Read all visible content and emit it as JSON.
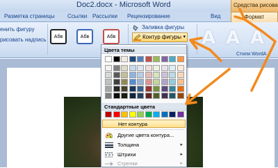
{
  "window": {
    "title": "Doc2.docx - Microsoft Word"
  },
  "context_group": {
    "label": "Средства рисования"
  },
  "tabs": [
    {
      "label": "Разметка страницы"
    },
    {
      "label": "Ссылки"
    },
    {
      "label": "Рассылки"
    },
    {
      "label": "Рецензирование"
    },
    {
      "label": "Вид"
    },
    {
      "label": "Формат"
    }
  ],
  "ribbon": {
    "change_shape": "енить фигуру",
    "draw_text": "рисовать надпись",
    "style_swatch_label": "Абв",
    "shape_fill": "Заливка фигуры",
    "shape_outline": "Контур фигуры",
    "wordart_styles": "Стили WordA",
    "bigA_letter": "A"
  },
  "menu": {
    "theme_colors_header": "Цвета темы",
    "standard_colors_header": "Стандартные цвета",
    "no_outline": "Нет контура",
    "more_colors": "Другие цвета контура...",
    "weight": "Толщина",
    "dashes": "Штрихи",
    "arrows": "Стрелки",
    "theme_top_row": [
      "#ffffff",
      "#000000",
      "#eeece1",
      "#1f497d",
      "#4f81bd",
      "#c0504d",
      "#9bbb59",
      "#8064a2",
      "#4bacc6",
      "#f79646"
    ],
    "theme_shades": [
      [
        "#f2f2f2",
        "#7f7f7f",
        "#ddd9c3",
        "#c6d9f0",
        "#dbe5f1",
        "#f2dcdb",
        "#ebf1dd",
        "#e5e0ec",
        "#dbeef3",
        "#fdeada"
      ],
      [
        "#d8d8d8",
        "#595959",
        "#c4bd97",
        "#8db3e2",
        "#b8cce4",
        "#e5b9b7",
        "#d7e3bc",
        "#ccc1d9",
        "#b7dde8",
        "#fbd5b5"
      ],
      [
        "#bfbfbf",
        "#3f3f3f",
        "#938953",
        "#548dd4",
        "#95b3d7",
        "#d99694",
        "#c3d69b",
        "#b2a2c7",
        "#92cddc",
        "#fac08f"
      ],
      [
        "#a5a5a5",
        "#262626",
        "#494429",
        "#17365d",
        "#366092",
        "#953734",
        "#76923c",
        "#5f497a",
        "#31859b",
        "#e36c09"
      ],
      [
        "#7f7f7f",
        "#0c0c0c",
        "#1d1b10",
        "#0f243e",
        "#244061",
        "#632423",
        "#4f6128",
        "#3f3151",
        "#205867",
        "#974806"
      ]
    ],
    "standard_colors": [
      "#c00000",
      "#ff0000",
      "#ffc000",
      "#ffff00",
      "#92d050",
      "#00b050",
      "#00b0f0",
      "#0070c0",
      "#002060",
      "#7030a0"
    ]
  },
  "annotation": {
    "arrow_color": "#f28a1e"
  }
}
